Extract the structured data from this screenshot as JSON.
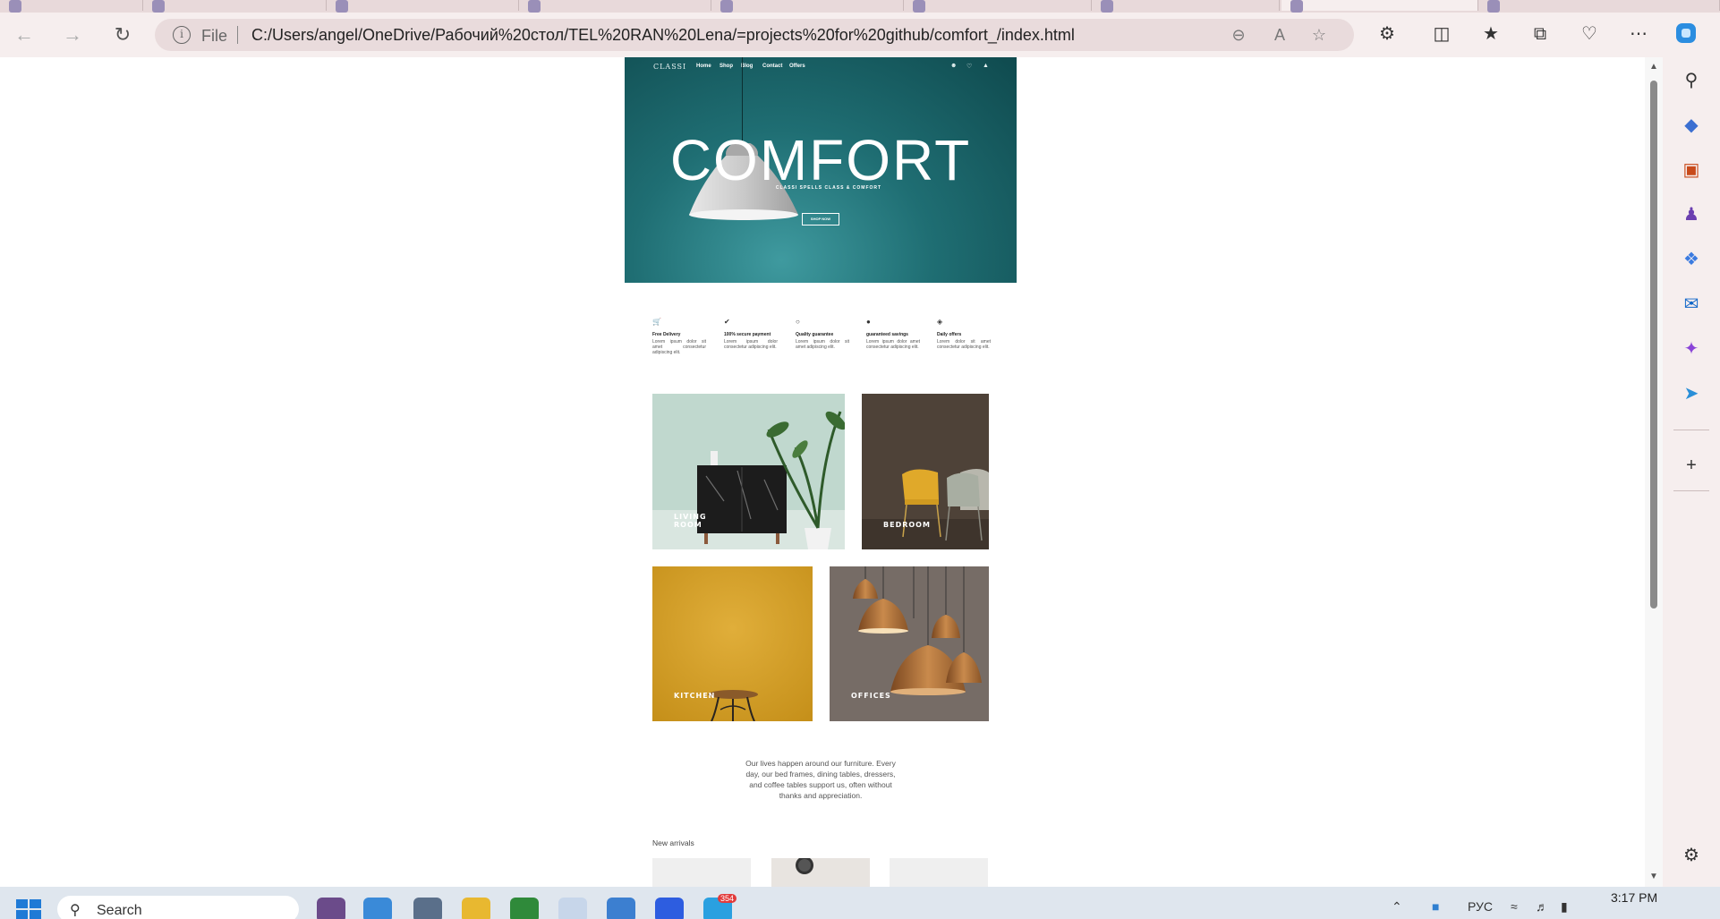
{
  "browser": {
    "url": "C:/Users/angel/OneDrive/Рабочий%20стол/TEL%20RAN%20Lena/=projects%20for%20github/comfort_/index.html",
    "scheme_label": "File",
    "icons": {
      "back": "back-arrow-icon",
      "forward": "forward-arrow-icon",
      "refresh": "refresh-icon",
      "info": "info-icon",
      "zoom": "zoom-out-icon",
      "read_aloud": "read-aloud-icon",
      "favorite": "star-icon",
      "extensions": "puzzle-icon",
      "split": "split-screen-icon",
      "favorites": "favorites-icon",
      "collections": "collections-icon",
      "performance": "heart-pulse-icon",
      "menu": "more-icon",
      "copilot": "copilot-icon"
    },
    "accent_color": "#1f6e73"
  },
  "site": {
    "logo": "CLASSI",
    "nav": [
      "Home",
      "Shop",
      "Blog",
      "Contact",
      "Offers"
    ],
    "hero": {
      "title": "COMFORT",
      "subtitle": "CLASSI SPELLS CLASS & COMFORT",
      "cta": "SHOP NOW"
    },
    "features": [
      {
        "icon": "cart-icon",
        "title": "Free Delivery",
        "text": "Lorem ipsum dolor sit amet consectetur adipiscing elit."
      },
      {
        "icon": "check-circle-icon",
        "title": "100% secure payment",
        "text": "Lorem ipsum dolor consectetur adipiscing elit."
      },
      {
        "icon": "lock-icon",
        "title": "Quality guarantee",
        "text": "Lorem ipsum dolor sit amet adipiscing elit."
      },
      {
        "icon": "coin-icon",
        "title": "guaranteed savings",
        "text": "Lorem ipsum dolor amet consectetur adipiscing elit."
      },
      {
        "icon": "tag-icon",
        "title": "Daily offers",
        "text": "Lorem dolor sit amet consectetur adipiscing elit."
      }
    ],
    "categories": [
      {
        "label": "LIVING ROOM",
        "line1": "LIVING",
        "line2": "ROOM"
      },
      {
        "label": "BEDROOM"
      },
      {
        "label": "KITCHEN"
      },
      {
        "label": "OFFICES"
      }
    ],
    "about": "Our lives happen around our furniture. Every day, our bed frames, dining tables, dressers, and coffee tables support us, often without thanks and appreciation.",
    "new_arrivals_title": "New arrivals"
  },
  "taskbar": {
    "search_placeholder": "Search",
    "language": "РУС",
    "time": "3:17 PM",
    "badge": "354"
  }
}
